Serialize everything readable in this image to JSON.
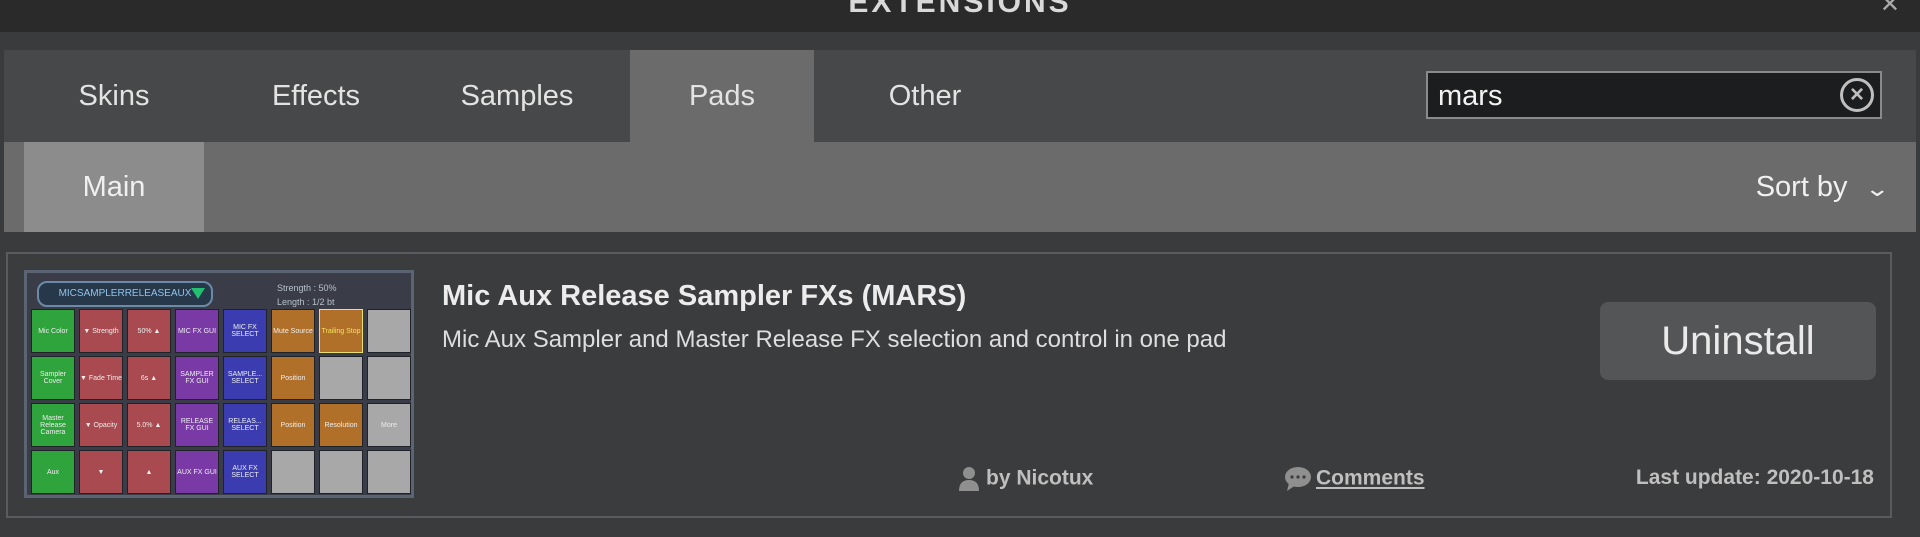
{
  "window": {
    "title": "EXTENSIONS"
  },
  "tabs": [
    {
      "label": "Skins"
    },
    {
      "label": "Effects"
    },
    {
      "label": "Samples"
    },
    {
      "label": "Pads",
      "active": true
    },
    {
      "label": "Other"
    }
  ],
  "search": {
    "value": "mars"
  },
  "subtabs": [
    {
      "label": "Main"
    }
  ],
  "sort": {
    "label": "Sort by"
  },
  "extension": {
    "title": "Mic Aux Release Sampler FXs (MARS)",
    "description": "Mic Aux Sampler and Master Release FX selection and control in one pad",
    "author": "by Nicotux",
    "comments_label": "Comments",
    "last_update": "Last update: 2020-10-18",
    "action_label": "Uninstall",
    "thumbnail": {
      "header": "MICSAMPLERRELEASEAUX",
      "strength": "Strength : 50%",
      "length": "Length : 1/2 bt",
      "grid": [
        [
          "Mic Color",
          "▼ Strength",
          "50% ▲",
          "MIC FX GUI",
          "MIC FX SELECT",
          "Mute Source",
          "Trailing Stop",
          ""
        ],
        [
          "Sampler Cover",
          "▼ Fade Time",
          "6s ▲",
          "SAMPLER FX GUI",
          "SAMPLE... SELECT",
          "Position",
          "",
          ""
        ],
        [
          "Master Release Camera",
          "▼ Opacity",
          "5.0% ▲",
          "RELEASE FX GUI",
          "RELEAS... SELECT",
          "Position",
          "Resolution",
          "More"
        ],
        [
          "Aux",
          "▼",
          "▲",
          "AUX FX GUI",
          "AUX FX SELECT",
          "",
          "",
          ""
        ]
      ]
    }
  },
  "colors": {
    "tab_active": "#6b6b6b",
    "pad_green": "#2fa33c",
    "pad_red": "#a84a4f",
    "pad_purple": "#7a3aa6",
    "pad_blue": "#3a3cb0",
    "pad_orange": "#b0702a",
    "pad_grey": "#a8a8a8"
  }
}
